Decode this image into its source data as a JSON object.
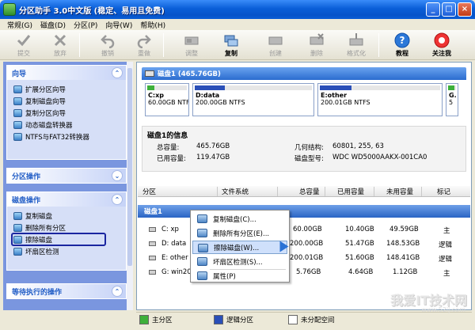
{
  "window": {
    "title": "分区助手 3.0中文版 (稳定、易用且免费)",
    "controls": [
      "_",
      "□",
      "×"
    ]
  },
  "menu": [
    "常规(G)",
    "磁盘(D)",
    "分区(P)",
    "向导(W)",
    "帮助(H)"
  ],
  "toolbar": [
    {
      "label": "提交",
      "icon": "check-icon",
      "enabled": false
    },
    {
      "label": "放弃",
      "icon": "discard-icon",
      "enabled": false
    },
    {
      "label": "撤销",
      "icon": "undo-icon",
      "enabled": false
    },
    {
      "label": "重做",
      "icon": "redo-icon",
      "enabled": false
    },
    {
      "label": "调整",
      "icon": "resize-icon",
      "enabled": false
    },
    {
      "label": "复制",
      "icon": "copy-disk-icon",
      "enabled": true
    },
    {
      "label": "创建",
      "icon": "create-icon",
      "enabled": false
    },
    {
      "label": "删除",
      "icon": "delete-icon",
      "enabled": false
    },
    {
      "label": "格式化",
      "icon": "format-icon",
      "enabled": false
    },
    {
      "label": "教程",
      "icon": "help-icon",
      "enabled": true
    },
    {
      "label": "关注我",
      "icon": "follow-icon",
      "enabled": true
    }
  ],
  "sidebar": {
    "wizard": {
      "title": "向导",
      "items": [
        "扩展分区向导",
        "复制磁盘向导",
        "复制分区向导",
        "动态磁盘转换器",
        "NTFS与FAT32转换器"
      ]
    },
    "partition_ops": {
      "title": "分区操作"
    },
    "disk_ops": {
      "title": "磁盘操作",
      "items": [
        "复制磁盘",
        "删除所有分区",
        "擦除磁盘",
        "坏扇区检测"
      ],
      "highlighted": "擦除磁盘"
    },
    "pending": {
      "title": "等待执行的操作"
    }
  },
  "disk_map": {
    "title": "磁盘1 (465.76GB)",
    "partitions": [
      {
        "name": "C:xp",
        "size": "60.00GB NTFS",
        "used_fraction": 0.17
      },
      {
        "name": "D:data",
        "size": "200.00GB NTFS",
        "used_fraction": 0.26
      },
      {
        "name": "E:other",
        "size": "200.01GB NTFS",
        "used_fraction": 0.26
      },
      {
        "name": "G.",
        "size": "5",
        "used_fraction": 0.8
      }
    ]
  },
  "disk_info": {
    "title": "磁盘1的信息",
    "total_label": "总容量:",
    "total_value": "465.76GB",
    "used_label": "已用容量:",
    "used_value": "119.47GB",
    "geometry_label": "几何结构:",
    "geometry_value": "60801, 255, 63",
    "model_label": "磁盘型号:",
    "model_value": "WDC WD5000AAKX-001CA0"
  },
  "table": {
    "headers": [
      "分区",
      "文件系统",
      "总容量",
      "已用容量",
      "未用容量",
      "标记"
    ],
    "disk_label": "磁盘1",
    "rows": [
      {
        "part": "C:  xp",
        "total": "60.00GB",
        "used": "10.40GB",
        "free": "49.59GB",
        "flag": "主"
      },
      {
        "part": "D:  data",
        "total": "200.00GB",
        "used": "51.47GB",
        "free": "148.53GB",
        "flag": "逻辑"
      },
      {
        "part": "E:  other",
        "total": "200.01GB",
        "used": "51.60GB",
        "free": "148.41GB",
        "flag": "逻辑"
      },
      {
        "part": "G:  win200",
        "total": "5.76GB",
        "used": "4.64GB",
        "free": "1.12GB",
        "flag": "主"
      }
    ]
  },
  "context_menu": {
    "items": [
      "复制磁盘(C)...",
      "删除所有分区(E)...",
      "擦除磁盘(W)...",
      "坏扇区检测(S)...",
      "属性(P)"
    ],
    "hovered": "擦除磁盘(W)..."
  },
  "legend": {
    "primary": "主分区",
    "logical": "逻辑分区",
    "unallocated": "未分配空间",
    "colors": {
      "primary": "#3db03a",
      "logical": "#2a4fb8",
      "unallocated": "#ffffff"
    }
  },
  "watermark": {
    "text": "我爱IT技术网",
    "url": "www.52ij.com"
  }
}
